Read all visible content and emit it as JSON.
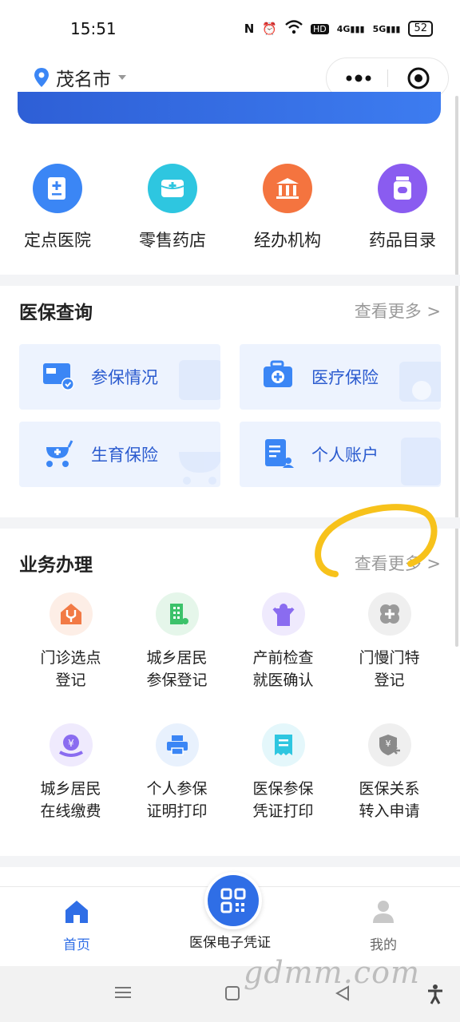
{
  "status_bar": {
    "time": "15:51",
    "battery": "52",
    "signal_4g": "4G",
    "signal_5g": "5G",
    "hd": "HD"
  },
  "header": {
    "city": "茂名市"
  },
  "quick_links": [
    {
      "label": "定点医院",
      "color": "#3b86f5",
      "icon": "hospital-icon"
    },
    {
      "label": "零售药店",
      "color": "#2ec6e0",
      "icon": "pharmacy-icon"
    },
    {
      "label": "经办机构",
      "color": "#f4743f",
      "icon": "institution-icon"
    },
    {
      "label": "药品目录",
      "color": "#8a5cf0",
      "icon": "medicine-icon"
    }
  ],
  "insurance_query": {
    "title": "医保查询",
    "more": "查看更多 >",
    "cards": [
      {
        "label": "参保情况"
      },
      {
        "label": "医疗保险"
      },
      {
        "label": "生育保险"
      },
      {
        "label": "个人账户"
      }
    ]
  },
  "business": {
    "title": "业务办理",
    "more": "查看更多 >",
    "items": [
      {
        "l1": "门诊选点",
        "l2": "登记",
        "bg": "#fdeee6",
        "fg": "#f27a45",
        "icon": "house-stethoscope-icon"
      },
      {
        "l1": "城乡居民",
        "l2": "参保登记",
        "bg": "#e5f6ea",
        "fg": "#3cc26a",
        "icon": "building-icon"
      },
      {
        "l1": "产前检查",
        "l2": "就医确认",
        "bg": "#efeafd",
        "fg": "#8a6cf0",
        "icon": "baby-icon"
      },
      {
        "l1": "门慢门特",
        "l2": "登记",
        "bg": "#efefef",
        "fg": "#9a9a9a",
        "icon": "medical-cross-icon"
      },
      {
        "l1": "城乡居民",
        "l2": "在线缴费",
        "bg": "#efeafd",
        "fg": "#8a6cf0",
        "icon": "payment-icon"
      },
      {
        "l1": "个人参保",
        "l2": "证明打印",
        "bg": "#e8f1fd",
        "fg": "#3b86f5",
        "icon": "printer-icon"
      },
      {
        "l1": "医保参保",
        "l2": "凭证打印",
        "bg": "#e4f7fb",
        "fg": "#2ec6e0",
        "icon": "receipt-icon"
      },
      {
        "l1": "医保关系",
        "l2": "转入申请",
        "bg": "#efefef",
        "fg": "#8a8a8a",
        "icon": "transfer-shield-icon"
      }
    ]
  },
  "bottom_nav": {
    "home": "首页",
    "certificate": "医保电子凭证",
    "mine": "我的",
    "active_color": "#2f6ee6"
  },
  "watermark": "gdmm.com"
}
